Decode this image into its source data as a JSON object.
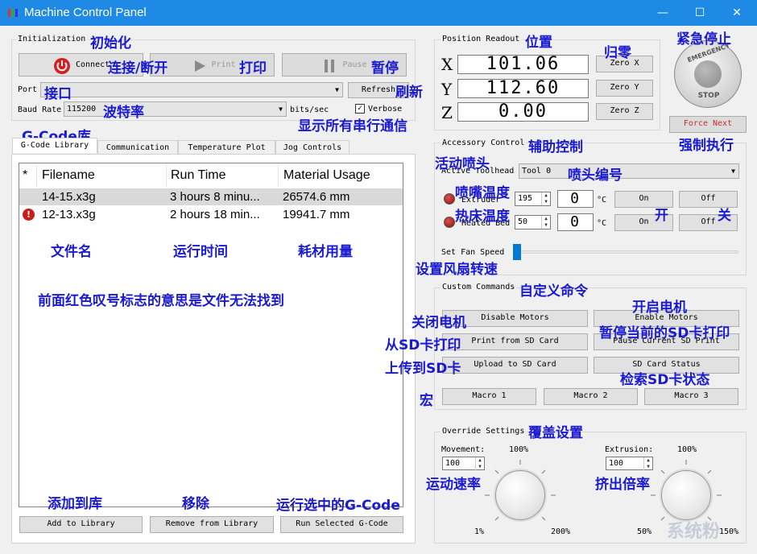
{
  "window": {
    "title": "Machine Control Panel",
    "minimize": "—",
    "maximize": "☐",
    "close": "✕"
  },
  "initialization": {
    "group_label": "Initialization",
    "connect_label": "Connect",
    "print_label": "Print",
    "pause_label": "Pause",
    "port_label": "Port",
    "port_value": "",
    "refresh_label": "Refresh",
    "baud_label": "Baud Rate",
    "baud_value": "115200",
    "bits_label": "bits/sec",
    "verbose_label": "Verbose",
    "verbose_checked": true
  },
  "tabs": [
    {
      "label": "G-Code Library",
      "active": true
    },
    {
      "label": "Communication",
      "active": false
    },
    {
      "label": "Temperature Plot",
      "active": false
    },
    {
      "label": "Jog Controls",
      "active": false
    }
  ],
  "library": {
    "columns": [
      "*",
      "Filename",
      "Run Time",
      "Material Usage"
    ],
    "rows": [
      {
        "flag": "",
        "filename": "14-15.x3g",
        "run_time": "3 hours 8 minu...",
        "material": "26574.6 mm",
        "selected": true
      },
      {
        "flag": "!",
        "filename": "12-13.x3g",
        "run_time": "2 hours 18 min...",
        "material": "19941.7 mm",
        "selected": false
      }
    ],
    "add_label": "Add to Library",
    "remove_label": "Remove from Library",
    "run_label": "Run Selected G-Code"
  },
  "position": {
    "group_label": "Position Readout",
    "x_axis": "X",
    "y_axis": "Y",
    "z_axis": "Z",
    "x_value": "101.06",
    "y_value": "112.60",
    "z_value": "0.00",
    "zero_x": "Zero X",
    "zero_y": "Zero Y",
    "zero_z": "Zero Z"
  },
  "emergency": {
    "top_text": "EMERGENCY",
    "bottom_text": "STOP",
    "force_next": "Force Next"
  },
  "accessory": {
    "group_label": "Accessory Control",
    "toolhead_label": "Active Toolhead",
    "toolhead_value": "Tool 0",
    "extruder_label": "Extruder",
    "extruder_temp": "195",
    "extruder_readout": "0",
    "bed_label": "Heated Bed",
    "bed_temp": "50",
    "bed_readout": "0",
    "deg_unit": "°C",
    "on_label": "On",
    "off_label": "Off",
    "fan_label": "Set Fan Speed",
    "fan_level": 0
  },
  "custom": {
    "group_label": "Custom Commands",
    "disable_motors": "Disable Motors",
    "enable_motors": "Enable Motors",
    "print_sd": "Print from SD Card",
    "pause_sd": "Pause Current SD Print",
    "upload_sd": "Upload to SD Card",
    "sd_status": "SD Card Status",
    "macro1": "Macro 1",
    "macro2": "Macro 2",
    "macro3": "Macro 3"
  },
  "override": {
    "group_label": "Override Settings",
    "movement_label": "Movement:",
    "movement_pct": "100%",
    "movement_value": "100",
    "movement_min": "1%",
    "movement_max": "200%",
    "extrusion_label": "Extrusion:",
    "extrusion_pct": "100%",
    "extrusion_value": "100",
    "extrusion_min": "50%",
    "extrusion_max": "150%"
  },
  "annotations": {
    "init": "初始化",
    "connect": "连接/断开",
    "print": "打印",
    "pause": "暂停",
    "port": "接口",
    "refresh": "刷新",
    "baud": "波特率",
    "verbose": "显示所有串行通信",
    "gcode_lib": "G-Code库",
    "filename": "文件名",
    "runtime": "运行时间",
    "material": "耗材用量",
    "note": "前面红色叹号标志的意思是文件无法找到",
    "add": "添加到库",
    "remove": "移除",
    "run": "运行选中的G-Code",
    "position": "位置",
    "zero": "归零",
    "estop": "紧急停止",
    "force": "强制执行",
    "accessory": "辅助控制",
    "toolhead": "活动喷头",
    "tool_no": "喷头编号",
    "nozzle_temp": "喷嘴温度",
    "bed_temp": "热床温度",
    "on": "开",
    "off": "关",
    "fan": "设置风扇转速",
    "custom": "自定义命令",
    "disable": "关闭电机",
    "enable": "开启电机",
    "print_sd": "从SD卡打印",
    "pause_sd": "暂停当前的SD卡打印",
    "upload": "上传到SD卡",
    "status": "检索SD卡状态",
    "macro": "宏",
    "override": "覆盖设置",
    "movement": "运动速率",
    "extrusion": "挤出倍率"
  },
  "watermark": "系统粉"
}
